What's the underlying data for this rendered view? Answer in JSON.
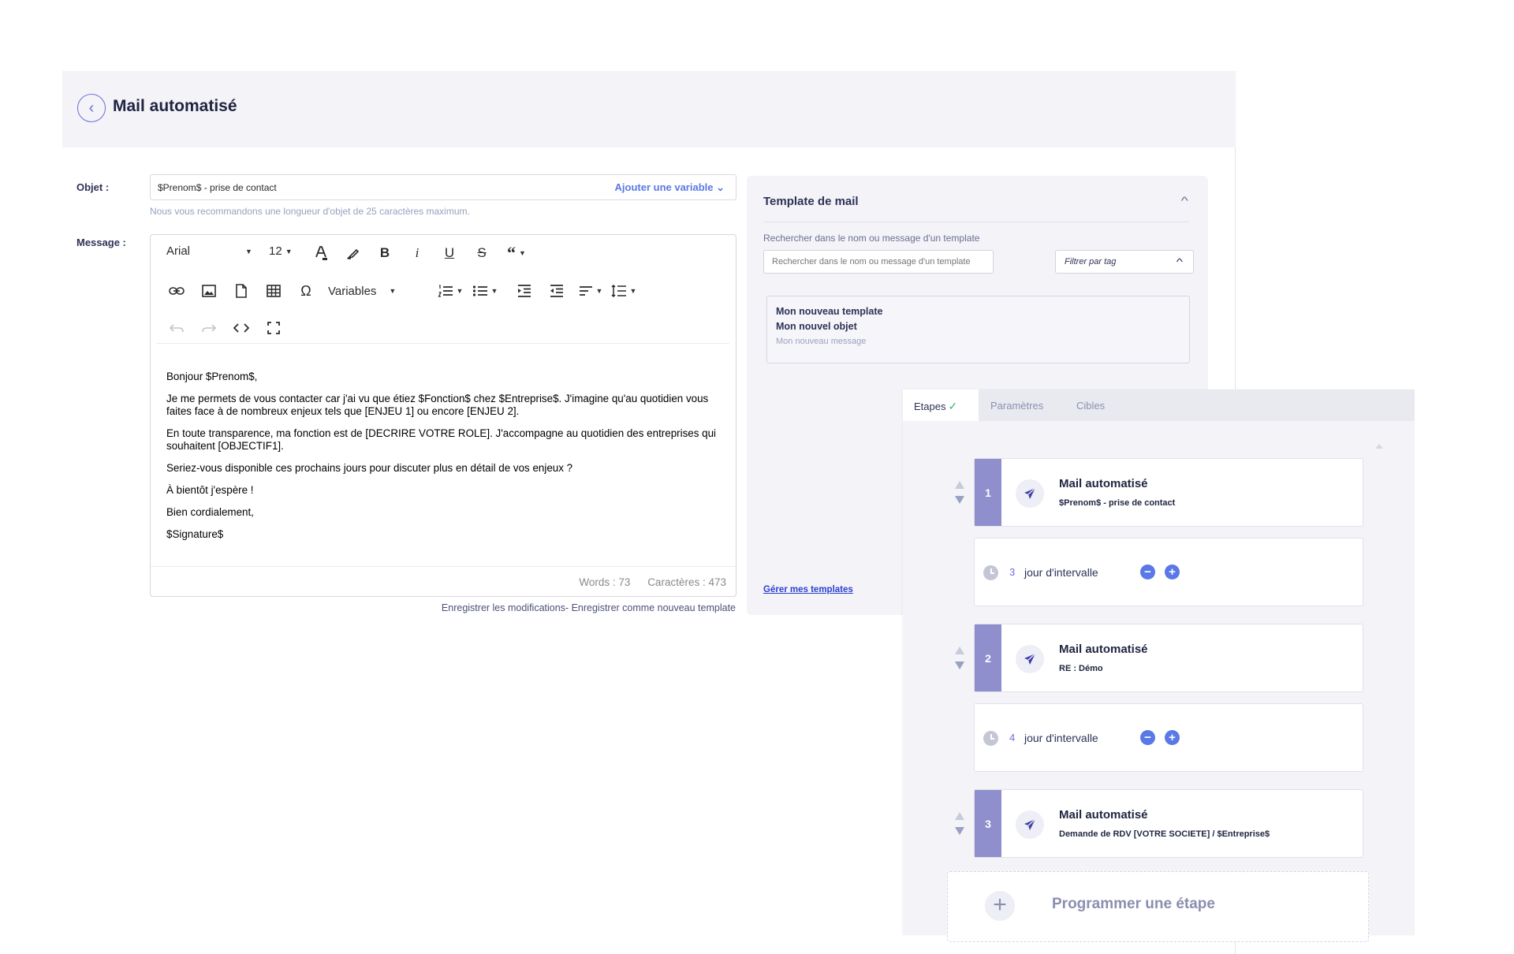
{
  "header": {
    "title": "Mail automatisé"
  },
  "form": {
    "subject_label": "Objet :",
    "subject_value": "$Prenom$ - prise de contact",
    "add_variable_label": "Ajouter une variable ⌄",
    "subject_hint": "Nous vous recommandons une longueur d'objet de 25 caractères maximum.",
    "message_label": "Message :",
    "save_links": "Enregistrer les modifications- Enregistrer comme nouveau template"
  },
  "editor": {
    "font_family": "Arial",
    "font_size": "12",
    "variables_label": "Variables",
    "paragraphs": [
      "Bonjour $Prenom$,",
      "Je me permets de vous contacter car j'ai vu que étiez $Fonction$ chez $Entreprise$. J'imagine qu'au quotidien vous faites face à de nombreux enjeux tels que [ENJEU 1] ou encore [ENJEU 2].",
      "En toute transparence, ma fonction est de [DECRIRE VOTRE ROLE]. J'accompagne au quotidien des entreprises qui souhaitent [OBJECTIF1].",
      "Seriez-vous disponible ces prochains jours pour discuter plus en détail de vos enjeux ?",
      "À bientôt j'espère !",
      "Bien cordialement,",
      "$Signature$"
    ],
    "words": "Words : 73",
    "chars": "Caractères : 473"
  },
  "templates": {
    "title": "Template de mail",
    "search_label": "Rechercher dans le nom ou message d'un template",
    "search_placeholder": "Rechercher dans le nom ou message d'un template",
    "filter_label": "Filtrer par tag",
    "card": {
      "name": "Mon nouveau template",
      "subject": "Mon nouvel objet",
      "message": "Mon nouveau message"
    },
    "manage_link": "Gérer mes templates"
  },
  "sequence": {
    "tabs": [
      "Etapes",
      "Paramètres",
      "Cibles"
    ],
    "active_tab_check": "✓",
    "steps": [
      {
        "number": "1",
        "title": "Mail automatisé",
        "subtitle": "$Prenom$ - prise de contact"
      },
      {
        "number": "2",
        "title": "Mail automatisé",
        "subtitle": "RE : Démo"
      },
      {
        "number": "3",
        "title": "Mail automatisé",
        "subtitle": "Demande de RDV [VOTRE SOCIETE] / $Entreprise$"
      }
    ],
    "delays": [
      {
        "value": "3",
        "label": "jour d'intervalle"
      },
      {
        "value": "4",
        "label": "jour d'intervalle"
      }
    ],
    "add_step_label": "Programmer une étape"
  },
  "colors": {
    "accent": "#5a78e6",
    "step_number_bg": "#8f8fce",
    "panel_bg": "#f3f3f8",
    "success_check": "#3bb56a"
  }
}
